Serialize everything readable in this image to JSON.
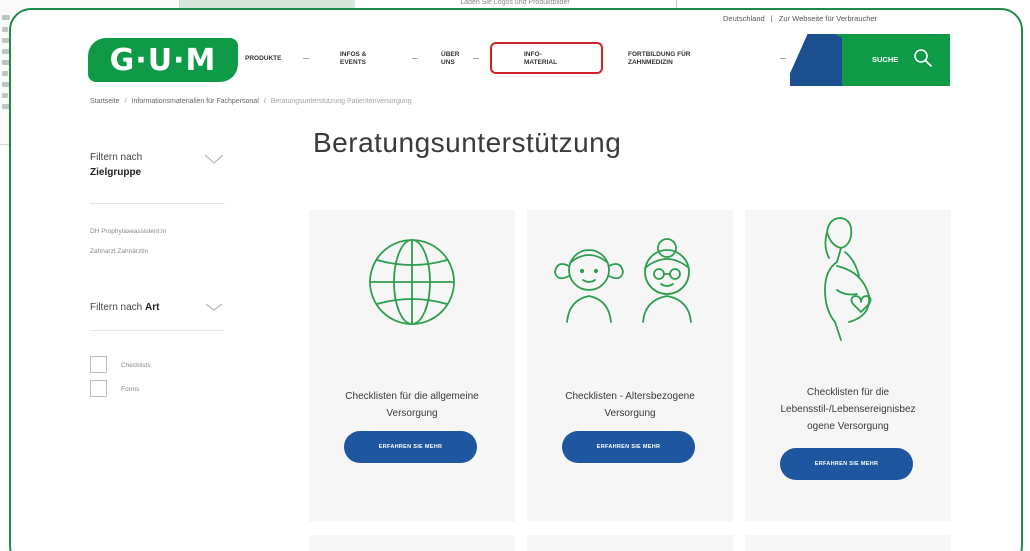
{
  "util_links": [
    "Deutschland",
    "|",
    "Zur Webseite für Verbraucher"
  ],
  "bg_topline": "Laden Sie Logos und Produktbilder",
  "logo": {
    "text": "G·U·M"
  },
  "nav": {
    "items": [
      {
        "label": "PRODUKTE"
      },
      {
        "label": "INFOS &\nEVENTS"
      },
      {
        "label": "ÜBER\nUNS"
      },
      {
        "label": "INFO-\nMATERIAL"
      },
      {
        "label": "FORTBILDUNG FÜR\nZAHNMEDIZIN"
      }
    ],
    "search_label": "SUCHE"
  },
  "breadcrumb": {
    "items": [
      "Startseite",
      "Informationsmaterialien für Fachpersonal",
      "Beratungsunterstützung Patientenversorgung"
    ]
  },
  "page_title": "Beratungsunterstützung",
  "sidebar": {
    "filter_group": {
      "prefix": "Filtern nach",
      "bold": "Zielgruppe"
    },
    "group_options": [
      "DH Prophylaxeassistent:in",
      "Zahnarzt Zahnärztin"
    ],
    "filter_type": {
      "prefix": "Filtern nach ",
      "bold": "Art"
    },
    "checkboxes": [
      {
        "label": "Checklists"
      },
      {
        "label": "Forms"
      }
    ]
  },
  "cards": [
    {
      "title": "Checklisten für die allgemeine\nVersorgung",
      "button": "ERFAHREN SIE MEHR",
      "icon": "globe-icon"
    },
    {
      "title": "Checklisten - Altersbezogene\nVersorgung",
      "button": "ERFAHREN SIE MEHR",
      "icon": "children-icon"
    },
    {
      "title": "Checklisten für die\nLebensstil-/Lebensereignisbez\nogene Versorgung",
      "button": "ERFAHREN SIE MEHR",
      "icon": "pregnant-woman-icon"
    }
  ],
  "colors": {
    "brand_green": "#0e9a46",
    "frame_green": "#1c8a4a",
    "button_blue": "#1e56a0",
    "highlight_red": "#d0212a",
    "icon_green": "#2e9e4f"
  }
}
